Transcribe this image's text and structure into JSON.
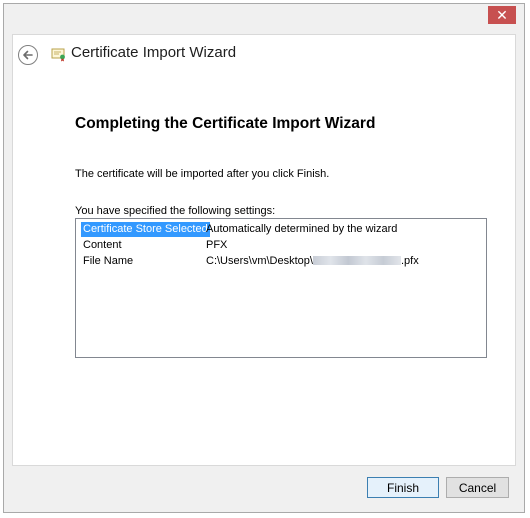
{
  "window": {
    "close_label": "✕"
  },
  "header": {
    "title": "Certificate Import Wizard",
    "back_icon": "back-arrow-icon",
    "wizard_icon": "certificate-icon"
  },
  "main": {
    "heading": "Completing the Certificate Import Wizard",
    "intro": "The certificate will be imported after you click Finish.",
    "settings_label": "You have specified the following settings:",
    "settings": [
      {
        "key": "Certificate Store Selected",
        "value": "Automatically determined by the wizard",
        "selected": true
      },
      {
        "key": "Content",
        "value": "PFX",
        "selected": false
      },
      {
        "key": "File Name",
        "value_prefix": "C:\\Users\\vm\\Desktop\\",
        "value_suffix": ".pfx",
        "selected": false
      }
    ]
  },
  "footer": {
    "finish_label": "Finish",
    "cancel_label": "Cancel"
  },
  "colors": {
    "selection": "#3399ff",
    "close_button": "#c75050",
    "default_button_border": "#3c7fb1"
  }
}
